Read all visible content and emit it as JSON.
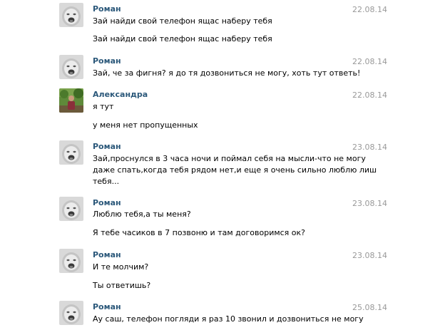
{
  "messages": [
    {
      "author": "Роман",
      "date": "22.08.14",
      "avatar": "baby-photo",
      "lines": [
        "Зай найди свой телефон ящас наберу тебя",
        "Зай найди свой телефон ящас наберу тебя"
      ]
    },
    {
      "author": "Роман",
      "date": "22.08.14",
      "avatar": "baby-photo",
      "lines": [
        "Зай, че за фигня? я до тя дозвониться не могу, хоть тут ответь!"
      ]
    },
    {
      "author": "Александра",
      "date": "22.08.14",
      "avatar": "outdoor-photo",
      "lines": [
        "я тут",
        "у меня нет пропущенных"
      ]
    },
    {
      "author": "Роман",
      "date": "23.08.14",
      "avatar": "baby-photo",
      "lines": [
        "Зай,проснулся в 3 часа ночи и поймал себя на мысли-что не могу",
        "даже спать,когда тебя рядом нет,и еще я очень сильно люблю лиш",
        "тебя..."
      ]
    },
    {
      "author": "Роман",
      "date": "23.08.14",
      "avatar": "baby-photo",
      "lines": [
        "Люблю тебя,а ты меня?",
        "Я тебе часиков в 7 позвоню и там договоримся ок?"
      ]
    },
    {
      "author": "Роман",
      "date": "23.08.14",
      "avatar": "baby-photo",
      "lines": [
        "И те молчим?",
        "Ты ответишь?"
      ]
    },
    {
      "author": "Роман",
      "date": "25.08.14",
      "avatar": "baby-photo",
      "lines": [
        "Ау саш, телефон погляди я раз 10 звонил и дозвониться не могу"
      ]
    }
  ]
}
